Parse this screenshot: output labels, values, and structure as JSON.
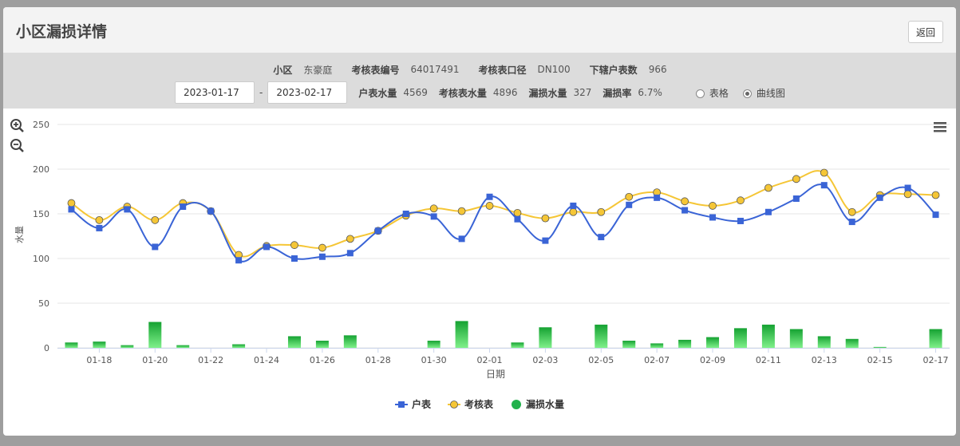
{
  "page": {
    "title": "小区漏损详情",
    "back_label": "返回"
  },
  "info": {
    "community_label": "小区",
    "community_value": "东豪庭",
    "meter_no_label": "考核表编号",
    "meter_no_value": "64017491",
    "meter_caliber_label": "考核表口径",
    "meter_caliber_value": "DN100",
    "sub_count_label": "下辖户表数",
    "sub_count_value": "966"
  },
  "filter": {
    "start_date": "2023-01-17",
    "end_date": "2023-02-17",
    "separator": "-",
    "household_label": "户表水量",
    "household_value": "4569",
    "meter_label": "考核表水量",
    "meter_value": "4896",
    "leak_label": "漏损水量",
    "leak_value": "327",
    "rate_label": "漏损率",
    "rate_value": "6.7%",
    "view_table_label": "表格",
    "view_chart_label": "曲线图",
    "selected_view": "曲线图"
  },
  "colors": {
    "household": "#3a64d6",
    "meter": "#f5c636",
    "leak": "#22b14c"
  },
  "icons": [
    "zoom-in-icon",
    "zoom-out-icon",
    "menu-icon"
  ],
  "chart_data": {
    "type": "line",
    "xlabel": "日期",
    "ylabel": "水量",
    "ylim": [
      0,
      250
    ],
    "yticks": [
      0,
      50,
      100,
      150,
      200,
      250
    ],
    "grid": true,
    "legend_position": "bottom",
    "dates": [
      "01-17",
      "01-18",
      "01-19",
      "01-20",
      "01-21",
      "01-22",
      "01-23",
      "01-24",
      "01-25",
      "01-26",
      "01-27",
      "01-28",
      "01-29",
      "01-30",
      "01-31",
      "02-01",
      "02-02",
      "02-03",
      "02-04",
      "02-05",
      "02-06",
      "02-07",
      "02-08",
      "02-09",
      "02-10",
      "02-11",
      "02-12",
      "02-13",
      "02-14",
      "02-15",
      "02-16",
      "02-17"
    ],
    "xtick_labels": [
      "01-18",
      "01-20",
      "01-22",
      "01-24",
      "01-26",
      "01-28",
      "01-30",
      "02-01",
      "02-03",
      "02-05",
      "02-07",
      "02-09",
      "02-11",
      "02-13",
      "02-15",
      "02-17"
    ],
    "series": [
      {
        "name": "户表",
        "type": "line",
        "marker": "square",
        "values": [
          155,
          134,
          155,
          113,
          158,
          153,
          98,
          113,
          100,
          102,
          106,
          131,
          150,
          147,
          122,
          169,
          144,
          120,
          159,
          124,
          160,
          168,
          154,
          146,
          142,
          152,
          167,
          182,
          141,
          168,
          179,
          149
        ]
      },
      {
        "name": "考核表",
        "type": "line",
        "marker": "circle",
        "values": [
          162,
          143,
          158,
          143,
          162,
          153,
          104,
          114,
          115,
          112,
          122,
          131,
          148,
          156,
          153,
          159,
          151,
          145,
          152,
          152,
          169,
          174,
          164,
          159,
          165,
          179,
          189,
          196,
          152,
          171,
          172,
          171
        ]
      },
      {
        "name": "漏损水量",
        "type": "bar",
        "values": [
          6,
          7,
          3,
          29,
          3,
          0,
          4,
          0,
          13,
          8,
          14,
          0,
          0,
          8,
          30,
          0,
          6,
          23,
          0,
          26,
          8,
          5,
          9,
          12,
          22,
          26,
          21,
          13,
          10,
          1,
          0,
          21
        ]
      }
    ]
  }
}
